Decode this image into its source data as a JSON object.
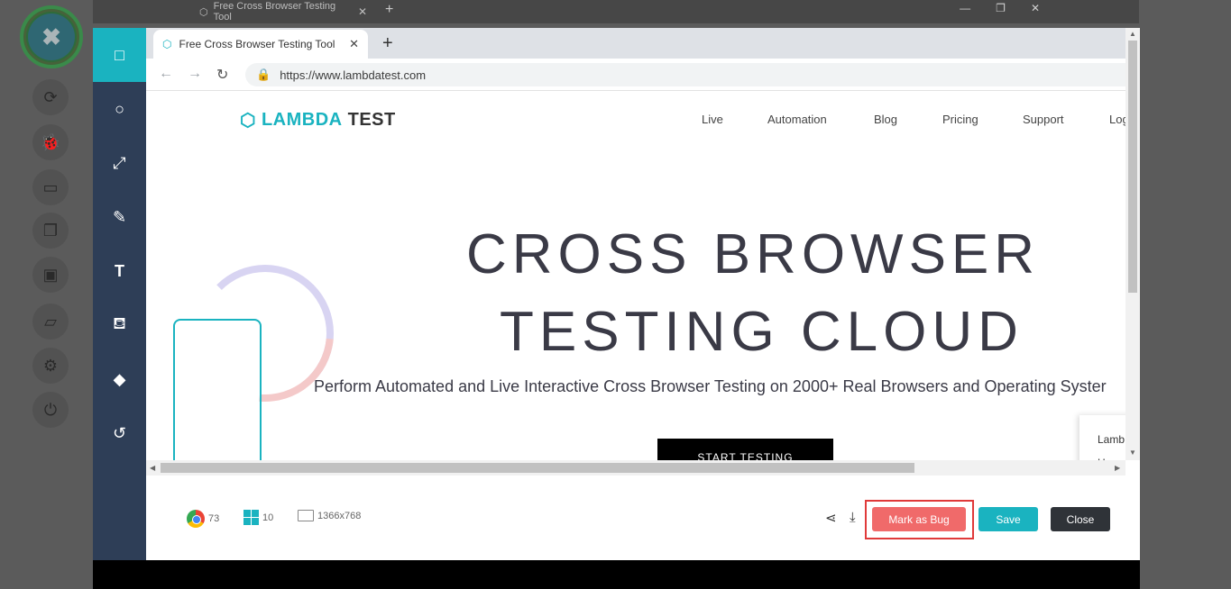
{
  "background_browser": {
    "tab_title": "Free Cross Browser Testing Tool",
    "new_tab_symbol": "+",
    "minimize": "—",
    "restore": "❐",
    "close": "✕"
  },
  "floating_tools": {
    "close_symbol": "✖",
    "icons": [
      "sync-icon",
      "bug-icon",
      "video-icon",
      "copy-icon",
      "desktop-icon",
      "folder-icon",
      "gear-icon",
      "power-icon"
    ]
  },
  "editor_tools": [
    "square-icon",
    "circle-icon",
    "line-icon",
    "pen-icon",
    "text-icon",
    "fill-icon",
    "eraser-icon",
    "undo-icon"
  ],
  "screenshot": {
    "tab_title": "Free Cross Browser Testing Tool",
    "url": "https://www.lambdatest.com",
    "logo_part1": "LAMBDA",
    "logo_part2": "TEST",
    "nav": [
      "Live",
      "Automation",
      "Blog",
      "Pricing",
      "Support",
      "Log"
    ],
    "hero_line1": "CROSS BROWSER",
    "hero_line2": "TESTING CLOUD",
    "subtitle": "Perform Automated and Live Interactive Cross Browser Testing on 2000+ Real Browsers and Operating Syster",
    "cta": "START TESTING",
    "chat_line1": "Lamb",
    "chat_line2": "Hey"
  },
  "footer": {
    "browser_version": "73",
    "os_version": "10",
    "resolution": "1366x768",
    "mark_bug_label": "Mark as Bug",
    "save_label": "Save",
    "close_label": "Close"
  },
  "colors": {
    "accent": "#1ab3c0",
    "toolbar": "#2e3e57",
    "bug_button": "#f06a6a",
    "highlight": "#e03a3a",
    "close_button": "#2f3338"
  }
}
